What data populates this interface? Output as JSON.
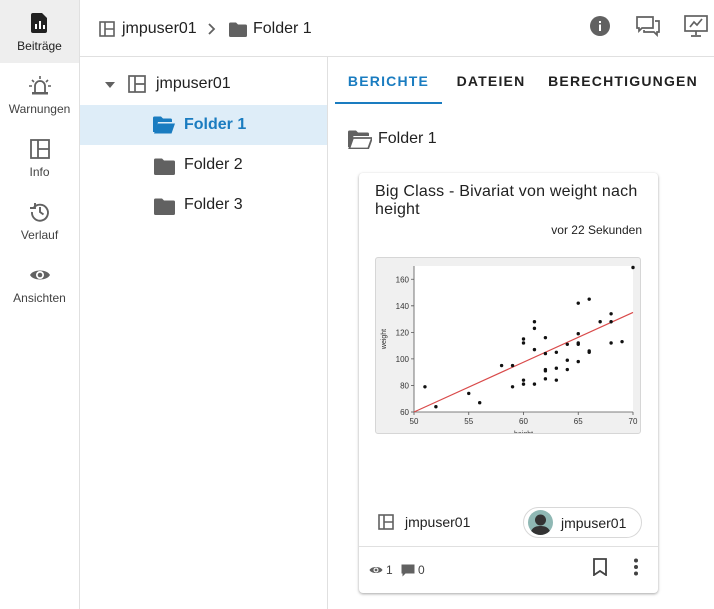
{
  "colors": {
    "accent": "#1a7cc0",
    "selected_bg": "#deedf8",
    "fit_line": "#d94a4a"
  },
  "rail": {
    "items": [
      {
        "label": "Beiträge",
        "icon": "posts-icon",
        "active": true
      },
      {
        "label": "Warnungen",
        "icon": "alarm-icon"
      },
      {
        "label": "Info",
        "icon": "info-panel-icon"
      },
      {
        "label": "Verlauf",
        "icon": "history-icon"
      },
      {
        "label": "Ansichten",
        "icon": "eye-icon"
      }
    ]
  },
  "topbar": {
    "breadcrumb": [
      {
        "label": "jmpuser01",
        "icon": "workspace-icon"
      },
      {
        "label": "Folder 1",
        "icon": "folder-icon"
      }
    ],
    "actions": [
      {
        "name": "info-button",
        "icon": "info-icon"
      },
      {
        "name": "comments-button",
        "icon": "comments-icon"
      },
      {
        "name": "presentation-button",
        "icon": "presentation-icon"
      }
    ]
  },
  "tree": {
    "root": {
      "label": "jmpuser01",
      "icon": "workspace-icon",
      "expanded": true
    },
    "folders": [
      {
        "label": "Folder 1",
        "selected": true
      },
      {
        "label": "Folder 2"
      },
      {
        "label": "Folder 3"
      }
    ]
  },
  "tabs": [
    {
      "label": "BERICHTE",
      "active": true
    },
    {
      "label": "DATEIEN"
    },
    {
      "label": "BERECHTIGUNGEN"
    }
  ],
  "content": {
    "folder_title": "Folder 1",
    "card": {
      "title": "Big Class - Bivariat von weight nach height",
      "time": "vor 22 Sekunden",
      "owner": "jmpuser01",
      "user": "jmpuser01",
      "views": "1",
      "comments": "0"
    }
  },
  "chart_data": {
    "type": "scatter",
    "xlabel": "height",
    "ylabel": "weight",
    "xlim": [
      50,
      70
    ],
    "ylim": [
      60,
      170
    ],
    "xticks": [
      50,
      55,
      60,
      65,
      70
    ],
    "yticks": [
      60,
      80,
      100,
      120,
      140,
      160
    ],
    "points": [
      [
        51,
        79
      ],
      [
        52,
        64
      ],
      [
        55,
        74
      ],
      [
        56,
        67
      ],
      [
        58,
        95
      ],
      [
        59,
        79
      ],
      [
        59,
        95
      ],
      [
        60,
        81
      ],
      [
        60,
        84
      ],
      [
        60,
        112
      ],
      [
        60,
        115
      ],
      [
        61,
        81
      ],
      [
        61,
        107
      ],
      [
        61,
        123
      ],
      [
        61,
        128
      ],
      [
        62,
        85
      ],
      [
        62,
        91
      ],
      [
        62,
        92
      ],
      [
        62,
        104
      ],
      [
        62,
        116
      ],
      [
        63,
        84
      ],
      [
        63,
        93
      ],
      [
        63,
        105
      ],
      [
        64,
        92
      ],
      [
        64,
        99
      ],
      [
        64,
        111
      ],
      [
        65,
        98
      ],
      [
        65,
        111
      ],
      [
        65,
        112
      ],
      [
        65,
        119
      ],
      [
        65,
        142
      ],
      [
        66,
        105
      ],
      [
        66,
        106
      ],
      [
        66,
        145
      ],
      [
        67,
        128
      ],
      [
        68,
        112
      ],
      [
        68,
        128
      ],
      [
        68,
        134
      ],
      [
        69,
        113
      ],
      [
        70,
        172
      ]
    ],
    "fit": {
      "x0": 50,
      "y0": 60,
      "x1": 70,
      "y1": 135
    }
  }
}
